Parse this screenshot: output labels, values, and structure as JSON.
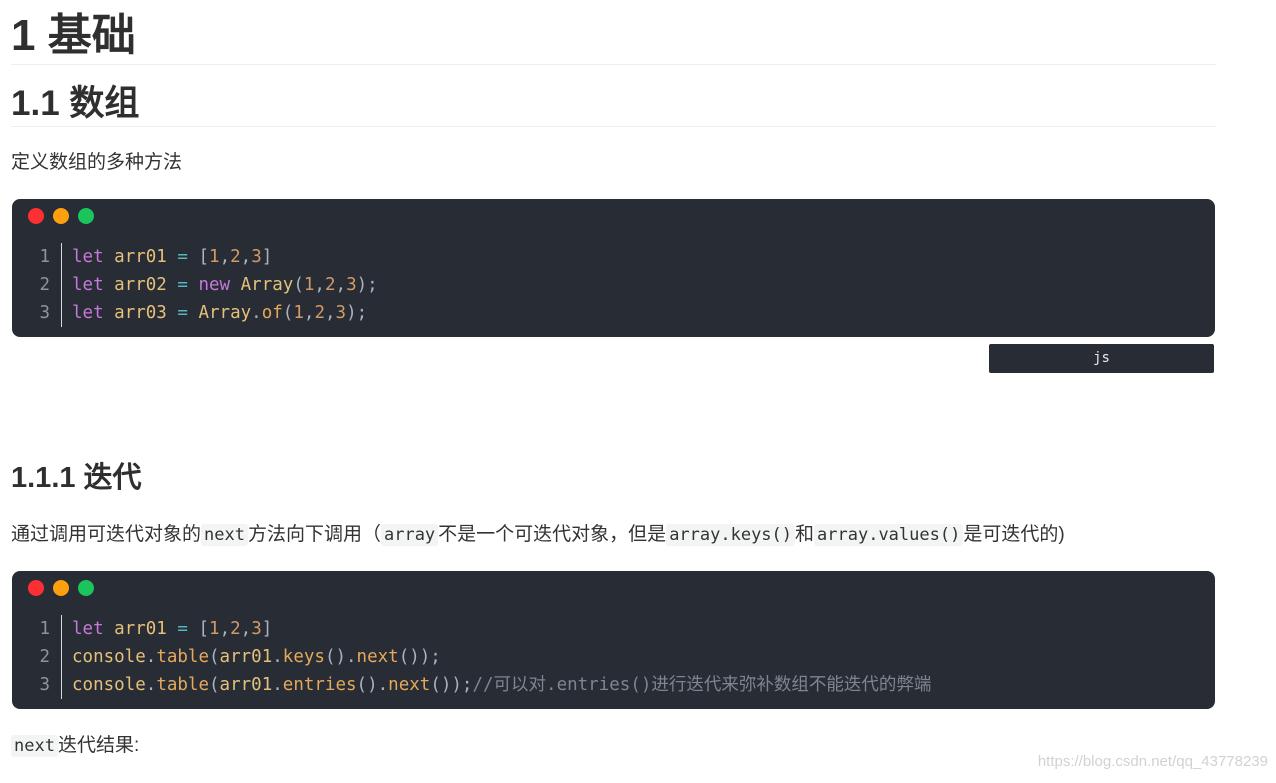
{
  "headings": {
    "h1": "1 基础",
    "h2": "1.1 数组",
    "h3": "1.1.1 迭代"
  },
  "para1": "定义数组的多种方法",
  "code_block_1": {
    "line_numbers": [
      "1",
      "2",
      "3"
    ],
    "lines": [
      [
        {
          "t": "let",
          "c": "kw"
        },
        {
          "t": " ",
          "c": "punc"
        },
        {
          "t": "arr01",
          "c": "var"
        },
        {
          "t": " ",
          "c": "punc"
        },
        {
          "t": "=",
          "c": "op"
        },
        {
          "t": " [",
          "c": "punc"
        },
        {
          "t": "1",
          "c": "num"
        },
        {
          "t": ",",
          "c": "punc"
        },
        {
          "t": "2",
          "c": "num"
        },
        {
          "t": ",",
          "c": "punc"
        },
        {
          "t": "3",
          "c": "num"
        },
        {
          "t": "]",
          "c": "punc"
        }
      ],
      [
        {
          "t": "let",
          "c": "kw"
        },
        {
          "t": " ",
          "c": "punc"
        },
        {
          "t": "arr02",
          "c": "var"
        },
        {
          "t": " ",
          "c": "punc"
        },
        {
          "t": "=",
          "c": "op"
        },
        {
          "t": " ",
          "c": "punc"
        },
        {
          "t": "new",
          "c": "kw"
        },
        {
          "t": " ",
          "c": "punc"
        },
        {
          "t": "Array",
          "c": "cls"
        },
        {
          "t": "(",
          "c": "punc"
        },
        {
          "t": "1",
          "c": "num"
        },
        {
          "t": ",",
          "c": "punc"
        },
        {
          "t": "2",
          "c": "num"
        },
        {
          "t": ",",
          "c": "punc"
        },
        {
          "t": "3",
          "c": "num"
        },
        {
          "t": ");",
          "c": "punc"
        }
      ],
      [
        {
          "t": "let",
          "c": "kw"
        },
        {
          "t": " ",
          "c": "punc"
        },
        {
          "t": "arr03",
          "c": "var"
        },
        {
          "t": " ",
          "c": "punc"
        },
        {
          "t": "=",
          "c": "op"
        },
        {
          "t": " ",
          "c": "punc"
        },
        {
          "t": "Array",
          "c": "cls"
        },
        {
          "t": ".",
          "c": "punc"
        },
        {
          "t": "of",
          "c": "fn"
        },
        {
          "t": "(",
          "c": "punc"
        },
        {
          "t": "1",
          "c": "num"
        },
        {
          "t": ",",
          "c": "punc"
        },
        {
          "t": "2",
          "c": "num"
        },
        {
          "t": ",",
          "c": "punc"
        },
        {
          "t": "3",
          "c": "num"
        },
        {
          "t": ");",
          "c": "punc"
        }
      ]
    ]
  },
  "lang_tag": "js",
  "para2": {
    "text1": "通过调用可迭代对象的",
    "code1": "next",
    "text2": "方法向下调用（",
    "code2": "array",
    "text3": "不是一个可迭代对象，但是",
    "code3": "array.keys()",
    "text4": "和",
    "code4": "array.values()",
    "text5": "是可迭代的)"
  },
  "code_block_2": {
    "line_numbers": [
      "1",
      "2",
      "3"
    ],
    "lines": [
      [
        {
          "t": "let",
          "c": "kw"
        },
        {
          "t": " ",
          "c": "punc"
        },
        {
          "t": "arr01",
          "c": "var"
        },
        {
          "t": " ",
          "c": "punc"
        },
        {
          "t": "=",
          "c": "op"
        },
        {
          "t": " [",
          "c": "punc"
        },
        {
          "t": "1",
          "c": "num"
        },
        {
          "t": ",",
          "c": "punc"
        },
        {
          "t": "2",
          "c": "num"
        },
        {
          "t": ",",
          "c": "punc"
        },
        {
          "t": "3",
          "c": "num"
        },
        {
          "t": "]",
          "c": "punc"
        }
      ],
      [
        {
          "t": "console",
          "c": "var"
        },
        {
          "t": ".",
          "c": "punc"
        },
        {
          "t": "table",
          "c": "fn"
        },
        {
          "t": "(",
          "c": "punc"
        },
        {
          "t": "arr01",
          "c": "var"
        },
        {
          "t": ".",
          "c": "punc"
        },
        {
          "t": "keys",
          "c": "fn"
        },
        {
          "t": "().",
          "c": "punc"
        },
        {
          "t": "next",
          "c": "fn"
        },
        {
          "t": "());",
          "c": "punc"
        }
      ],
      [
        {
          "t": "console",
          "c": "var"
        },
        {
          "t": ".",
          "c": "punc"
        },
        {
          "t": "table",
          "c": "fn"
        },
        {
          "t": "(",
          "c": "punc"
        },
        {
          "t": "arr01",
          "c": "var"
        },
        {
          "t": ".",
          "c": "punc"
        },
        {
          "t": "entries",
          "c": "fn"
        },
        {
          "t": "().",
          "c": "punc"
        },
        {
          "t": "next",
          "c": "fn"
        },
        {
          "t": "());",
          "c": "punc"
        },
        {
          "t": "//可以对.entries()进行迭代来弥补数组不能迭代的弊端",
          "c": "comment"
        }
      ]
    ]
  },
  "para3": {
    "code": "next",
    "text": "迭代结果:"
  },
  "watermark": "https://blog.csdn.net/qq_43778239",
  "colors": {
    "code_bg": "#282c34",
    "dot_red": "#fc3033",
    "dot_yellow": "#fda00e",
    "dot_green": "#1cc45c"
  }
}
